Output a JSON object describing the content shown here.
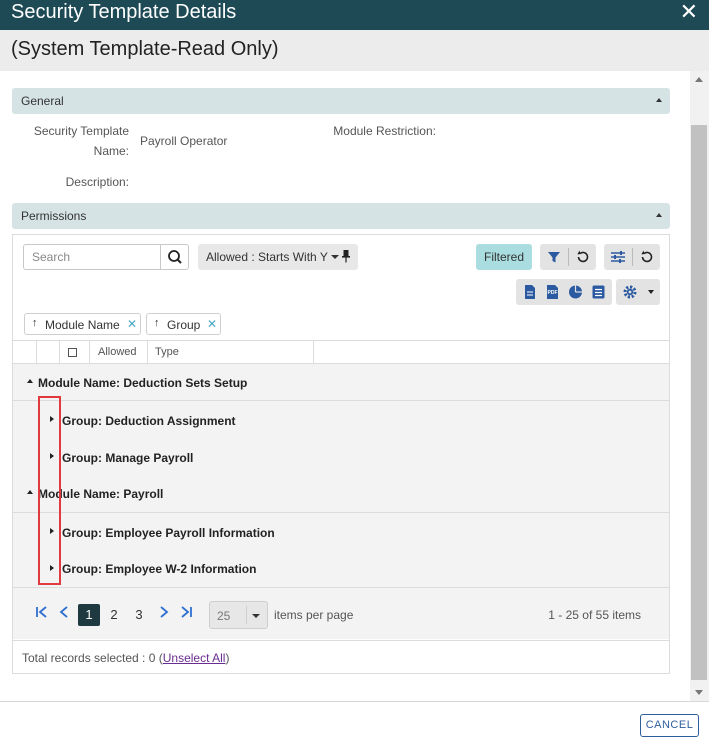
{
  "window": {
    "title": "Security Template Details",
    "subtitle": "(System Template-Read Only)"
  },
  "general": {
    "section_label": "General",
    "template_name_label_line1": "Security Template",
    "template_name_label_line2": "Name:",
    "template_name_value": "Payroll Operator",
    "module_restriction_label": "Module Restriction:",
    "description_label": "Description:"
  },
  "permissions": {
    "section_label": "Permissions",
    "search": {
      "placeholder": "Search"
    },
    "filter_chip": "Allowed : Starts With Y",
    "filtered_label": "Filtered",
    "sort_chips": [
      {
        "label": "Module Name",
        "arrow": "↑"
      },
      {
        "label": "Group",
        "arrow": "↑"
      }
    ],
    "columns": [
      "Allowed",
      "Type"
    ],
    "rows": [
      {
        "level": 0,
        "label": "Module Name: Deduction Sets Setup",
        "expanded": true
      },
      {
        "level": 1,
        "label": "Group: Deduction Assignment",
        "expanded": false
      },
      {
        "level": 1,
        "label": "Group: Manage Payroll",
        "expanded": false
      },
      {
        "level": 0,
        "label": "Module Name: Payroll",
        "expanded": true
      },
      {
        "level": 1,
        "label": "Group: Employee Payroll Information",
        "expanded": false
      },
      {
        "level": 1,
        "label": "Group: Employee W-2 Information",
        "expanded": false
      }
    ]
  },
  "pager": {
    "pages": [
      "1",
      "2",
      "3"
    ],
    "active_page": "1",
    "page_size": "25",
    "items_per_page_label": "items per page",
    "info": "1 - 25 of 55 items"
  },
  "footer": {
    "records_text": "Total records selected : 0 (",
    "unselect_label": "Unselect All",
    "records_text_end": ")"
  },
  "actions": {
    "cancel_label": "CANCEL"
  },
  "colors": {
    "titlebar": "#1e4a56",
    "section_bar": "#d6e3e5",
    "filtered": "#a9dde0",
    "link": "#6a2d91",
    "highlight": "#e0393e",
    "pager_nav": "#2f6fd0"
  },
  "icons": {
    "close": "close-icon",
    "search": "search-icon",
    "filter": "funnel-icon",
    "reset": "refresh-icon",
    "columns": "sliders-icon",
    "excel": "file-icon",
    "pdf": "pdf-icon",
    "chart": "pie-chart-icon",
    "report": "list-doc-icon",
    "settings": "gear-icon",
    "pin": "pin-icon"
  }
}
